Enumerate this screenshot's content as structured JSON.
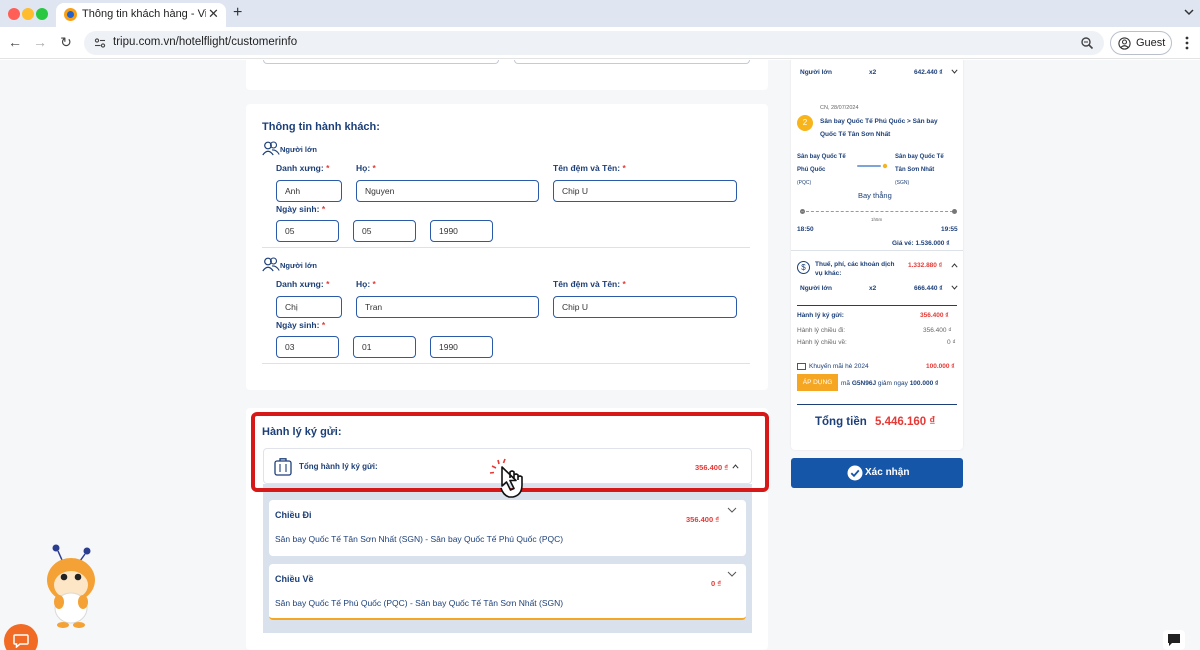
{
  "browser": {
    "tab_title": "Thông tin khách hàng - Vietra",
    "url": "tripu.com.vn/hotelflight/customerinfo",
    "guest_label": "Guest"
  },
  "passengers": {
    "section_title": "Thông tin hành khách:",
    "labels": {
      "title": "Danh xưng:",
      "last_name": "Họ:",
      "middle_first": "Tên đệm và Tên:",
      "dob": "Ngày sinh:",
      "required_mark": "*"
    },
    "list": [
      {
        "type": "Người lớn",
        "title": "Anh",
        "last_name": "Nguyen",
        "first_name": "Chip U",
        "day": "05",
        "month": "05",
        "year": "1990"
      },
      {
        "type": "Người lớn",
        "title": "Chị",
        "last_name": "Tran",
        "first_name": "Chip U",
        "day": "03",
        "month": "01",
        "year": "1990"
      }
    ]
  },
  "baggage": {
    "section_title": "Hành lý ký gửi:",
    "total_label": "Tổng hành lý ký gửi:",
    "total_value": "356.400 ₫",
    "segments": [
      {
        "title": "Chiều Đi",
        "price": "356.400 ₫",
        "route": "Sân bay Quốc Tế Tân Sơn Nhất (SGN) - Sân bay Quốc Tế Phú Quốc (PQC)"
      },
      {
        "title": "Chiều Về",
        "price": "0 ₫",
        "route": "Sân bay Quốc Tế Phú Quốc (PQC) - Sân bay Quốc Tế Tân Sơn Nhất (SGN)"
      }
    ]
  },
  "summary": {
    "outbound_adult": {
      "label": "Người lớn",
      "qty": "x2",
      "price": "642.440 ₫"
    },
    "return_flight": {
      "step": "2",
      "date": "CN, 28/07/2024",
      "route": [
        "Sân bay Quốc Tế Phú Quốc > Sân bay",
        "Quốc Tế Tân Sơn Nhất"
      ],
      "from_airport": [
        "Sân bay Quốc Tế",
        "Phú Quốc",
        "(PQC)"
      ],
      "to_airport": [
        "Sân bay Quốc Tế",
        "Tân Sơn Nhất",
        "(SGN)"
      ],
      "flight_type": "Bay thẳng",
      "duration": "1h5m",
      "depart_time": "18:50",
      "arrive_time": "19:55",
      "fare": "Giá vé: 1.536.000 ₫"
    },
    "tax": {
      "label": [
        "Thuế, phí, các khoản dịch",
        "vụ khác:"
      ],
      "value": "1.332.880 ₫",
      "adult_label": "Người lớn",
      "adult_qty": "x2",
      "adult_price": "666.440 ₫"
    },
    "baggage": {
      "label": "Hành lý ký gửi:",
      "value": "356.400 ₫",
      "out_label": "Hành lý chiều đi:",
      "out_value": "356.400 ₫",
      "ret_label": "Hành lý chiều về:",
      "ret_value": "0 ₫"
    },
    "promo": {
      "label": "Khuyến mãi hè 2024",
      "value": "100.000 ₫",
      "apply_label": "ÁP DỤNG",
      "code_text_pre": "mã",
      "code": "G5N96J",
      "code_text_post": "giảm ngay",
      "discount": "100.000 ₫"
    },
    "total_label": "Tổng tiền",
    "total_value": "5.446.160 ₫",
    "confirm_label": "Xác nhận"
  }
}
